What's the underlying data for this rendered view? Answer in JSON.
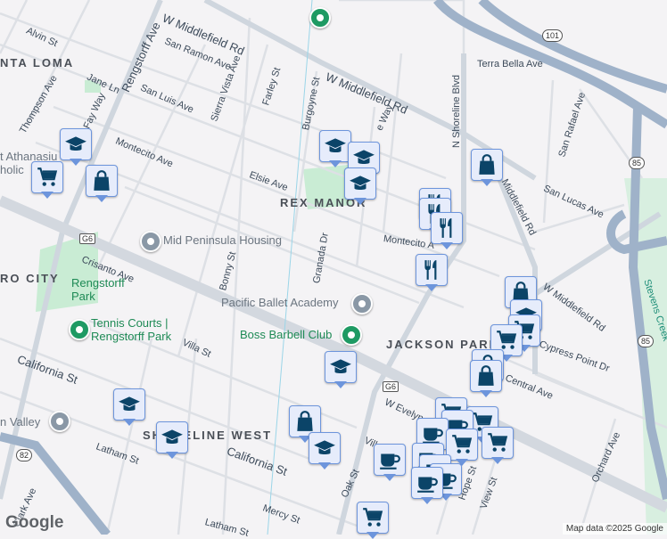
{
  "streets": {
    "w_middlefield_1": "W Middlefield Rd",
    "w_middlefield_2": "W Middlefield Rd",
    "alvin": "Alvin St",
    "san_ramon": "San Ramon Ave",
    "rengstorff": "Rengstorff Ave",
    "sierra_vista": "Sierra Vista Ave",
    "farley": "Farley St",
    "burgoyne": "Burgoyne St",
    "jane": "Jane Ln",
    "san_luis": "San Luis Ave",
    "thompson": "Thompson Ave",
    "fay": "Fay Way",
    "montecito_1": "Montecito Ave",
    "elsie": "Elsie Ave",
    "crisanto": "Crisanto Ave",
    "bonny": "Bonny St",
    "granada": "Granada Dr",
    "montecito_2": "Montecito A",
    "shoreline": "N Shoreline Blvd",
    "terra_bella": "Terra Bella Ave",
    "san_rafael": "San Rafael Ave",
    "san_lucas": "San Lucas Ave",
    "middlefield_3": "Middlefield Rd",
    "w_middlefield_3": "W Middlefield Rd",
    "cypress": "Cypress Point Dr",
    "central": "Central Ave",
    "california_1": "California St",
    "villa_1": "Villa St",
    "california_2": "California St",
    "w_evelyn": "W Evelyn",
    "villa_2": "Villa St",
    "oak": "Oak St",
    "hope": "Hope St",
    "view": "View St",
    "orchard": "Orchard Ave",
    "latham_1": "Latham St",
    "latham_2": "Latham St",
    "mercy": "Mercy St",
    "clark": "Clark Ave",
    "bryant_way": "e Way",
    "stevens_creek": "Stevens Creek"
  },
  "areas": {
    "santa_loma": "NTA LOMA",
    "rex_manor": "REX MANOR",
    "jackson_park": "JACKSON PARK",
    "shoreline_west": "SHORELINE WEST",
    "centro_city": "RO CITY"
  },
  "pois": {
    "mid_peninsula": "Mid Peninsula Housing",
    "pacific_ballet": "Pacific Ballet Academy",
    "boss_barbell": "Boss Barbell Club",
    "tennis_1": "Tennis Courts |",
    "tennis_2": "Rengstorff Park",
    "rengstorff_park_1": "Rengstorff",
    "rengstorff_park_2": "Park",
    "st_athanasius_1": "t Athanasiu",
    "st_athanasius_2": "holic",
    "temple": "n Valley"
  },
  "shields": {
    "g6_1": "G6",
    "g6_2": "G6",
    "us101": "101",
    "ca85_1": "85",
    "ca85_2": "85",
    "ca82": "82"
  },
  "footer": {
    "copyright": "Map data ©2025 Google",
    "logo": "Google"
  },
  "colors": {
    "marker_bg": "#e6ecfb",
    "marker_border": "#6d95dc",
    "icon": "#0b4468",
    "park": "#c9ecd4",
    "highway": "#9fb2c9"
  }
}
